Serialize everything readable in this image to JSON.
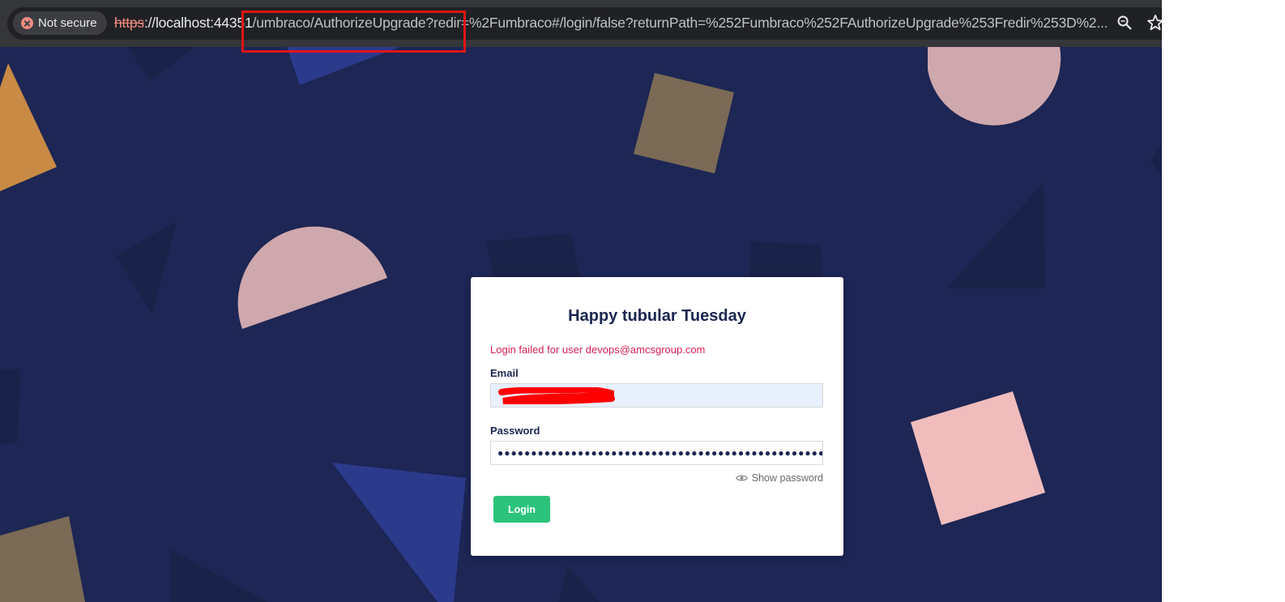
{
  "browser": {
    "security_chip": {
      "icon": "not-secure-icon",
      "label": "Not secure"
    },
    "url": {
      "scheme": "https",
      "host": "://localhost:44351",
      "path": "/umbraco/AuthorizeUpgrade?redir=%2Fumbraco#/login/false?returnPath=%252Fumbraco%252FAuthorizeUpgrade%253Fredir%253D%2..."
    },
    "icons": [
      "zoom-icon",
      "bookmark-star-icon"
    ],
    "annotation_color": "#e01515"
  },
  "login": {
    "greeting": "Happy tubular Tuesday",
    "error_message": "Login failed for user devops@amcsgroup.com",
    "email_label": "Email",
    "email_value": "",
    "password_label": "Password",
    "password_value": "●●●●●●●●●●●●●●●●●●●●●●●●●●●●●●●●●●●●●●●●●●●●●●●●●●●●",
    "show_password_label": "Show password",
    "login_button": "Login"
  },
  "colors": {
    "background": "#1d2654",
    "error": "#d42054",
    "button": "#2bc37c",
    "redaction": "#ff0000"
  }
}
